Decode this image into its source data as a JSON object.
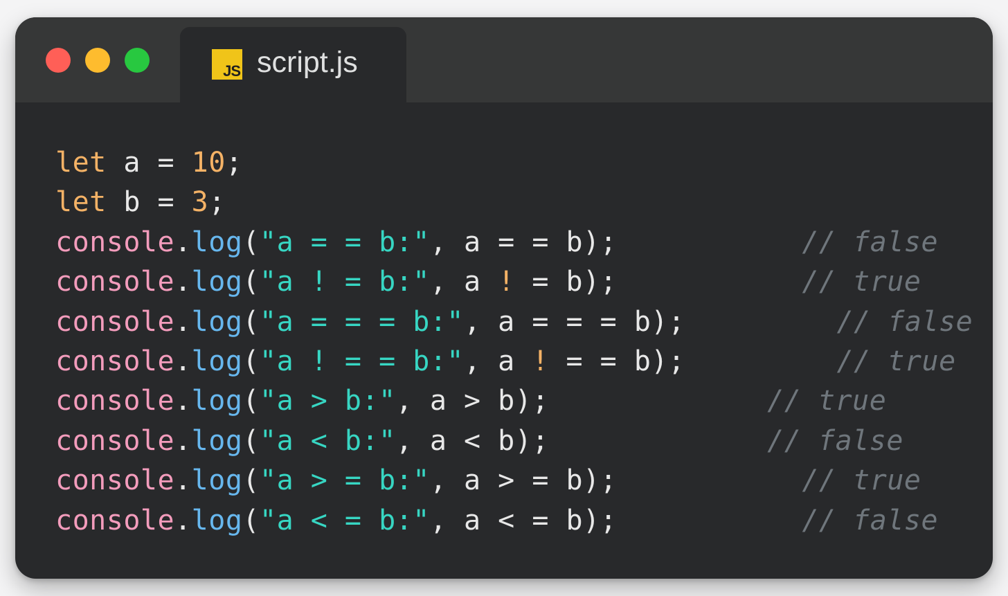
{
  "window": {
    "background": "#28292b",
    "titlebar_background": "#363737",
    "controls": [
      {
        "name": "close-button",
        "color": "#ff5f57"
      },
      {
        "name": "minimize-button",
        "color": "#febc2e"
      },
      {
        "name": "maximize-button",
        "color": "#28c840"
      }
    ]
  },
  "tab": {
    "icon": "js-file-icon",
    "icon_text": "JS",
    "title": "script.js"
  },
  "colors": {
    "keyword": "#f4b266",
    "number": "#f4b266",
    "plain": "#e8e8e8",
    "object": "#f39cbc",
    "method": "#67b7ee",
    "string": "#37d6c3",
    "bang": "#f4b266",
    "comment": "#6f767c"
  },
  "code_lines": [
    {
      "tokens": [
        {
          "t": "let",
          "k": "keyword"
        },
        {
          "t": " a = ",
          "k": "plain"
        },
        {
          "t": "10",
          "k": "number"
        },
        {
          "t": ";",
          "k": "plain"
        }
      ],
      "comment": "",
      "comment_col": 0
    },
    {
      "tokens": [
        {
          "t": "let",
          "k": "keyword"
        },
        {
          "t": " b = ",
          "k": "plain"
        },
        {
          "t": "3",
          "k": "number"
        },
        {
          "t": ";",
          "k": "plain"
        }
      ],
      "comment": "",
      "comment_col": 0
    },
    {
      "tokens": [
        {
          "t": "console",
          "k": "object"
        },
        {
          "t": ".",
          "k": "plain"
        },
        {
          "t": "log",
          "k": "method"
        },
        {
          "t": "(",
          "k": "plain"
        },
        {
          "t": "\"a = = b:\"",
          "k": "string"
        },
        {
          "t": ", a = = b);",
          "k": "plain"
        }
      ],
      "comment": "// false",
      "comment_col": 43
    },
    {
      "tokens": [
        {
          "t": "console",
          "k": "object"
        },
        {
          "t": ".",
          "k": "plain"
        },
        {
          "t": "log",
          "k": "method"
        },
        {
          "t": "(",
          "k": "plain"
        },
        {
          "t": "\"a ! = b:\"",
          "k": "string"
        },
        {
          "t": ", a ",
          "k": "plain"
        },
        {
          "t": "!",
          "k": "bang"
        },
        {
          "t": " = b);",
          "k": "plain"
        }
      ],
      "comment": "// true",
      "comment_col": 43
    },
    {
      "tokens": [
        {
          "t": "console",
          "k": "object"
        },
        {
          "t": ".",
          "k": "plain"
        },
        {
          "t": "log",
          "k": "method"
        },
        {
          "t": "(",
          "k": "plain"
        },
        {
          "t": "\"a = = = b:\"",
          "k": "string"
        },
        {
          "t": ", a = = = b);",
          "k": "plain"
        }
      ],
      "comment": "// false",
      "comment_col": 45
    },
    {
      "tokens": [
        {
          "t": "console",
          "k": "object"
        },
        {
          "t": ".",
          "k": "plain"
        },
        {
          "t": "log",
          "k": "method"
        },
        {
          "t": "(",
          "k": "plain"
        },
        {
          "t": "\"a ! = = b:\"",
          "k": "string"
        },
        {
          "t": ", a ",
          "k": "plain"
        },
        {
          "t": "!",
          "k": "bang"
        },
        {
          "t": " = = b);",
          "k": "plain"
        }
      ],
      "comment": "// true",
      "comment_col": 45
    },
    {
      "tokens": [
        {
          "t": "console",
          "k": "object"
        },
        {
          "t": ".",
          "k": "plain"
        },
        {
          "t": "log",
          "k": "method"
        },
        {
          "t": "(",
          "k": "plain"
        },
        {
          "t": "\"a > b:\"",
          "k": "string"
        },
        {
          "t": ", a > b);",
          "k": "plain"
        }
      ],
      "comment": "// true",
      "comment_col": 41
    },
    {
      "tokens": [
        {
          "t": "console",
          "k": "object"
        },
        {
          "t": ".",
          "k": "plain"
        },
        {
          "t": "log",
          "k": "method"
        },
        {
          "t": "(",
          "k": "plain"
        },
        {
          "t": "\"a < b:\"",
          "k": "string"
        },
        {
          "t": ", a < b);",
          "k": "plain"
        }
      ],
      "comment": "// false",
      "comment_col": 41
    },
    {
      "tokens": [
        {
          "t": "console",
          "k": "object"
        },
        {
          "t": ".",
          "k": "plain"
        },
        {
          "t": "log",
          "k": "method"
        },
        {
          "t": "(",
          "k": "plain"
        },
        {
          "t": "\"a > = b:\"",
          "k": "string"
        },
        {
          "t": ", a > = b);",
          "k": "plain"
        }
      ],
      "comment": "// true",
      "comment_col": 43
    },
    {
      "tokens": [
        {
          "t": "console",
          "k": "object"
        },
        {
          "t": ".",
          "k": "plain"
        },
        {
          "t": "log",
          "k": "method"
        },
        {
          "t": "(",
          "k": "plain"
        },
        {
          "t": "\"a < = b:\"",
          "k": "string"
        },
        {
          "t": ", a < = b);",
          "k": "plain"
        }
      ],
      "comment": "// false",
      "comment_col": 43
    }
  ]
}
